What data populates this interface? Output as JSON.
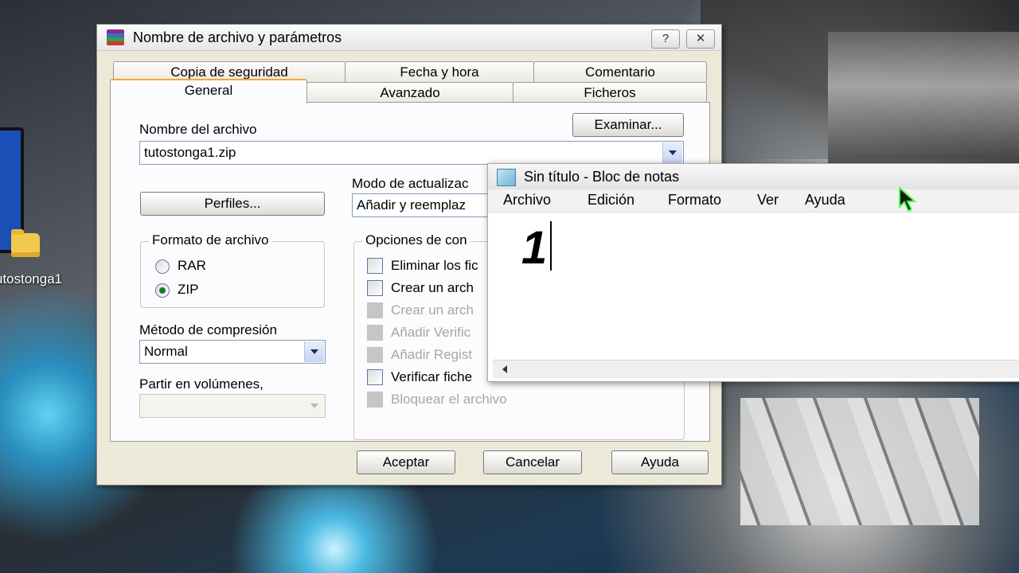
{
  "desktop": {
    "icon_label": "utostonga1"
  },
  "dialog": {
    "title": "Nombre de archivo y parámetros",
    "help_button": "?",
    "close_button": "✕",
    "tabs_row1": [
      "Copia de seguridad",
      "Fecha y hora",
      "Comentario"
    ],
    "tabs_row2": [
      "General",
      "Avanzado",
      "Ficheros"
    ],
    "active_tab": "General",
    "archive_name_label": "Nombre del archivo",
    "browse_button": "Examinar...",
    "archive_name_value": "tutostonga1.zip",
    "profiles_button": "Perfiles...",
    "update_mode_label": "Modo de actualizac",
    "update_mode_value": "Añadir y reemplaz",
    "format_group": {
      "title": "Formato de archivo",
      "options": [
        {
          "label": "RAR",
          "selected": false
        },
        {
          "label": "ZIP",
          "selected": true
        }
      ]
    },
    "compression_label": "Método de compresión",
    "compression_value": "Normal",
    "split_label": "Partir en volúmenes,",
    "split_value": "",
    "options_group": {
      "title": "Opciones de con",
      "items": [
        {
          "label": "Eliminar los fic",
          "checked": false,
          "enabled": true
        },
        {
          "label": "Crear un arch",
          "checked": false,
          "enabled": true
        },
        {
          "label": "Crear un arch",
          "checked": false,
          "enabled": false
        },
        {
          "label": "Añadir Verific",
          "checked": false,
          "enabled": false
        },
        {
          "label": "Añadir Regist",
          "checked": false,
          "enabled": false
        },
        {
          "label": "Verificar fiche",
          "checked": false,
          "enabled": true
        },
        {
          "label": "Bloquear el archivo",
          "checked": false,
          "enabled": false
        }
      ]
    },
    "buttons": {
      "ok": "Aceptar",
      "cancel": "Cancelar",
      "help": "Ayuda"
    }
  },
  "notepad": {
    "title": "Sin título - Bloc de notas",
    "menu": [
      "Archivo",
      "Edición",
      "Formato",
      "Ver",
      "Ayuda"
    ],
    "content": "1"
  }
}
